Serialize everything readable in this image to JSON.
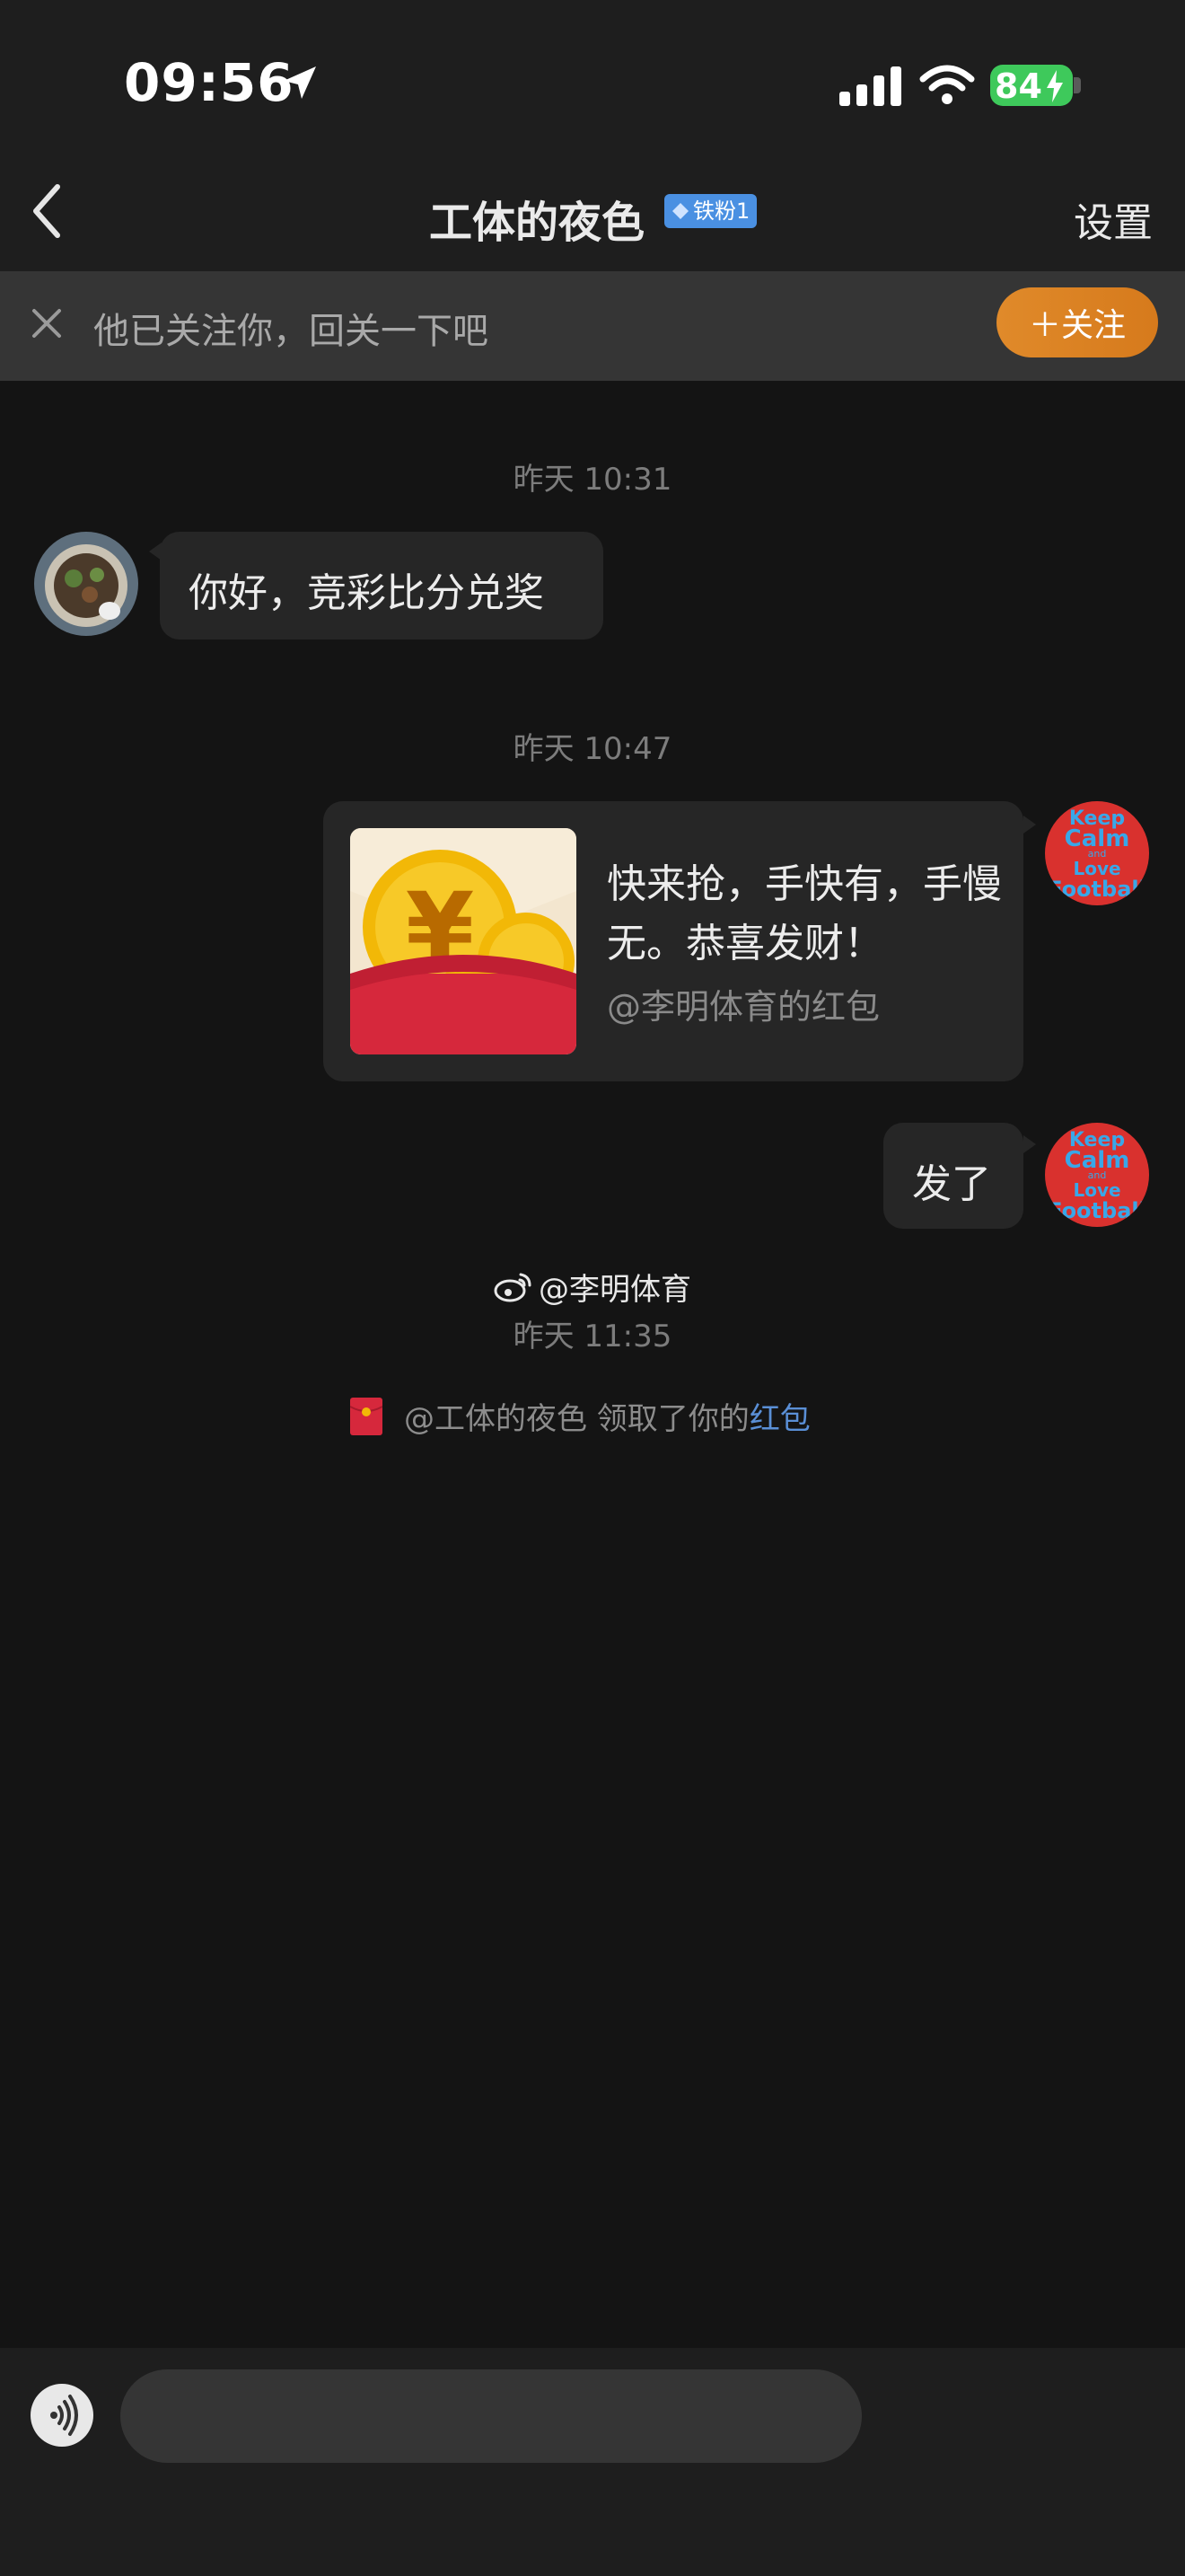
{
  "status_bar": {
    "time": "09:56",
    "battery": "84",
    "icons": [
      "location-arrow-icon",
      "cellular-signal-icon",
      "wifi-icon",
      "battery-icon",
      "charging-bolt-icon"
    ]
  },
  "nav": {
    "title": "工体的夜色",
    "fan_badge": "铁粉1",
    "settings_label": "设置",
    "icons": [
      "back-chevron-icon",
      "diamond-icon"
    ]
  },
  "follow_banner": {
    "text": "他已关注你，回关一下吧",
    "button_label": "＋关注",
    "icons": [
      "close-icon"
    ]
  },
  "messages": [
    {
      "type": "timestamp",
      "text": "昨天 10:31"
    },
    {
      "type": "text",
      "side": "left",
      "text": "你好，竞彩比分兑奖"
    },
    {
      "type": "timestamp",
      "text": "昨天 10:47"
    },
    {
      "type": "red_packet",
      "side": "right",
      "title": "快来抢，手快有，手慢无。恭喜发财！",
      "subtitle": "@李明体育的红包"
    },
    {
      "type": "text",
      "side": "right",
      "text": "发了"
    },
    {
      "type": "timestamp",
      "text": "昨天 11:35"
    },
    {
      "type": "system",
      "prefix": "@工体的夜色 领取了你的",
      "link": "红包"
    }
  ],
  "watermark": {
    "text": "@李明体育",
    "icon": "weibo-logo-icon"
  },
  "self_avatar_text": [
    "Keep",
    "Calm",
    "and",
    "Love",
    "Football"
  ],
  "composer": {
    "placeholder": "",
    "icons": [
      "voice-icon"
    ]
  },
  "colors": {
    "background": "#141414",
    "bar": "#1e1e1e",
    "bubble": "#262626",
    "follow_button": "#e08a2a",
    "badge": "#4a90e2",
    "battery": "#3ec95b",
    "link": "#5a8fd6"
  }
}
